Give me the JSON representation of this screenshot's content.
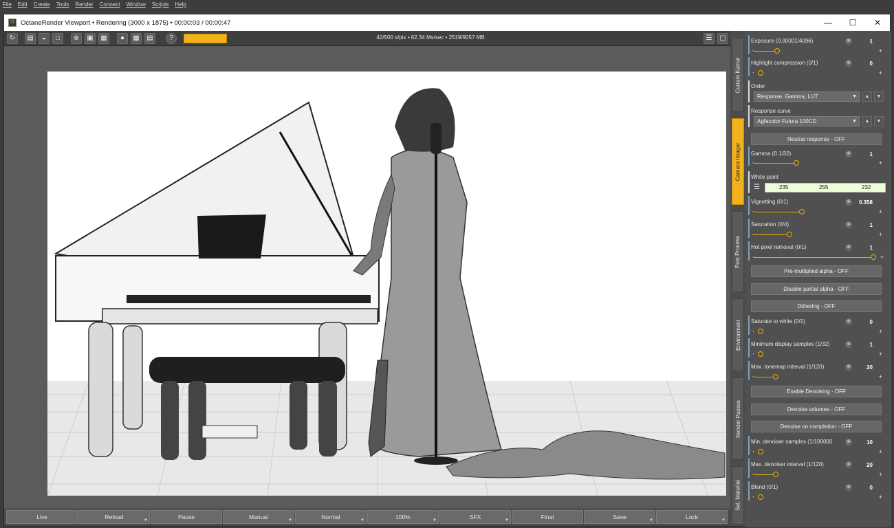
{
  "menu": [
    "File",
    "Edit",
    "Create",
    "Tools",
    "Render",
    "Connect",
    "Window",
    "Scripts",
    "Help"
  ],
  "window": {
    "title": "OctaneRender Viewport • Rendering (3000 x 1875) • 00:00:03 / 00:00:47",
    "min_icon": "minimize-icon",
    "max_icon": "maximize-icon",
    "close_icon": "close-icon"
  },
  "toolbar": {
    "stats": "42/500 s/pix • 62.34 Ms/sec • 2519/9057 MB",
    "progress_color": "#f2b21c",
    "help_label": "?"
  },
  "bottom_buttons": [
    {
      "label": "Live",
      "dropdown": false
    },
    {
      "label": "Reload",
      "dropdown": true
    },
    {
      "label": "Pause",
      "dropdown": false
    },
    {
      "label": "Manual",
      "dropdown": true
    },
    {
      "label": "Normal",
      "dropdown": true
    },
    {
      "label": "100%",
      "dropdown": true
    },
    {
      "label": "SFX",
      "dropdown": true
    },
    {
      "label": "Final",
      "dropdown": false
    },
    {
      "label": "Save",
      "dropdown": true
    },
    {
      "label": "Lock",
      "dropdown": true
    }
  ],
  "side_tabs": [
    "Current Kernel",
    "Camera Imager",
    "Post Process",
    "Environment",
    "Render Passes",
    "Sel. Material"
  ],
  "active_side_tab": "Camera Imager",
  "imager": {
    "exposure": {
      "label": "Exposure (0.00001/4096)",
      "value": "1",
      "level": 0.18
    },
    "highlight": {
      "label": "Highlight compression (0/1)",
      "value": "0",
      "level": 0.0
    },
    "order_label": "Order",
    "order_value": "Response, Gamma, LUT",
    "response_label": "Response curve",
    "response_value": "Agfacolor Futura 100CD",
    "neutral_response": "Neutral response - OFF",
    "gamma": {
      "label": "Gamma (0.1/32)",
      "value": "1",
      "level": 0.32
    },
    "white_point_label": "White point",
    "white_point": [
      "235",
      "255",
      "232"
    ],
    "vignetting": {
      "label": "Vignetting (0/1)",
      "value": "0.358",
      "level": 0.36
    },
    "saturation": {
      "label": "Saturation (0/4)",
      "value": "1",
      "level": 0.25
    },
    "hot_pixel": {
      "label": "Hot pixel removal (0/1)",
      "value": "1",
      "level": 1.0
    },
    "premultiplied_alpha": "Pre-multiplied alpha - OFF",
    "disable_partial_alpha": "Disable partial alpha - OFF",
    "dithering": "Dithering - OFF",
    "saturate_white": {
      "label": "Saturate to white (0/1)",
      "value": "0",
      "level": 0.0
    },
    "min_display": {
      "label": "Minimum display samples (1/32)",
      "value": "1",
      "level": 0.0
    },
    "max_tonemap": {
      "label": "Max. tonemap interval (1/120)",
      "value": "20",
      "level": 0.16
    },
    "enable_denoising": "Enable Denoising - OFF",
    "denoise_volumes": "Denoise volumes - OFF",
    "denoise_completion": "Denoise on completion - OFF",
    "min_denoiser": {
      "label": "Min. denoiser samples (1/100000",
      "value": "10",
      "level": 0.0
    },
    "max_denoiser": {
      "label": "Max. denoiser interval (1/120)",
      "value": "20",
      "level": 0.16
    },
    "blend": {
      "label": "Blend (0/1)",
      "value": "0",
      "level": 0.0
    }
  }
}
